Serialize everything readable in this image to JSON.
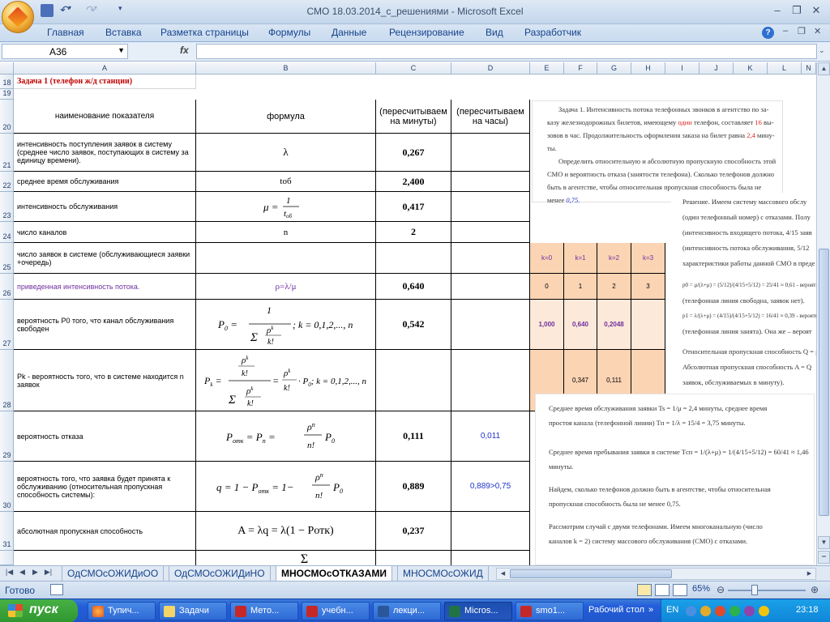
{
  "window": {
    "title": "СМО 18.03.2014_с_решениями - Microsoft Excel"
  },
  "ribbon": {
    "tabs": [
      "Главная",
      "Вставка",
      "Разметка страницы",
      "Формулы",
      "Данные",
      "Рецензирование",
      "Вид",
      "Разработчик"
    ]
  },
  "formula_bar": {
    "name_box": "A36",
    "fx": "fx",
    "value": ""
  },
  "columns": [
    "A",
    "B",
    "C",
    "D",
    "E",
    "F",
    "G",
    "H",
    "I",
    "J",
    "K",
    "L",
    "N"
  ],
  "rows": [
    "18",
    "19",
    "20",
    "21",
    "22",
    "23",
    "24",
    "25",
    "26",
    "27",
    "28",
    "29",
    "30",
    "31"
  ],
  "sheet": {
    "task_title": "Задача 1 (телефон ж/д станции)",
    "headers": {
      "name": "наименование показателя",
      "formula": "формула",
      "per_minute": "(пересчитываем на минуты)",
      "per_hour": "(пересчитываем на часы)"
    },
    "table": [
      {
        "label": "интенсивность поступления заявок в систему (среднее число заявок, поступающих в систему за единицу времени).",
        "formula": "λ",
        "value": "0,267",
        "hours": ""
      },
      {
        "label": "среднее время обслуживания",
        "formula": "tоб",
        "value": "2,400",
        "hours": ""
      },
      {
        "label": "интенсивность обслуживания",
        "formula": "μ = 1/tоб",
        "value": "0,417",
        "hours": ""
      },
      {
        "label": "число каналов",
        "formula": "n",
        "value": "2",
        "hours": ""
      },
      {
        "label": "число заявок в системе (обслуживающиеся заявки +очередь)",
        "formula": "",
        "value": "",
        "hours": ""
      },
      {
        "label": "приведенная интенсивность потока.",
        "formula": "ρ=λ/μ",
        "value": "0,640",
        "hours": ""
      },
      {
        "label": "вероятность P0 того, что канал обслуживания свободен",
        "formula": "P0 = 1 / Σ ρ^k/k! ; k = 0,1,2,..., n",
        "value": "0,542",
        "hours": ""
      },
      {
        "label": "Pk - вероятность того, что в системе находится n заявок",
        "formula": "Pk = (ρ^k/k!) / Σ ρ^k/k! = ρ^k/k! · P0 ; k = 0,1,2,..., n",
        "value": "",
        "hours": ""
      },
      {
        "label": "вероятность отказа",
        "formula": "Pотк = Pn = ρ^n/n! P0",
        "value": "0,111",
        "hours": "0,011"
      },
      {
        "label": "вероятность того, что заявка будет принята к обслуживанию (относительная пропускная способность системы):",
        "formula": "q = 1 − Pотк = 1− ρ^n/n! P0",
        "value": "0,889",
        "hours": "0,889>0,75"
      },
      {
        "label": "абсолютная пропускная способность",
        "formula": "A = λq = λ(1 − Pотк)",
        "value": "0,237",
        "hours": ""
      }
    ],
    "k_headers": [
      "k=0",
      "k=1",
      "k=2",
      "k=3"
    ],
    "k_values": [
      "0",
      "1",
      "2",
      "3"
    ],
    "p0_values": [
      "1,000",
      "0,640",
      "0,2048"
    ],
    "pk_values": [
      "0,347",
      "0,111"
    ]
  },
  "panel1": {
    "lines": [
      "Задача 1. Интенсивность потока телефонных звонков в агентство по за-",
      "казу железнодорожных билетов, имеющему",
      "один",
      "телефон, составляет",
      "16",
      "вы-",
      "зовов в час. Продолжительность оформления заказа на билет равна",
      "2,4",
      "мину-",
      "ты.",
      "Определить относительную и абсолютную пропускную способность",
      "этой СМО и вероятность отказа (занятости телефона). Сколько телефонов",
      "должно быть в агентстве, чтобы относительная пропускная способность была",
      "не менее",
      "0,75."
    ]
  },
  "panel2": {
    "lines": [
      "Решение. Имеем систему массового обслу",
      "(один телефонный номер) с отказами. Полу",
      "(интенсивность входящего потока, 4/15 заяв",
      "(интенсивность потока обслуживания, 5/12",
      "характеристики работы данной СМО в преде",
      "p0 = μ/(λ+μ) = (5/12)/(4/15+5/12) = 25/41 ≈ 0,61 - вероятнос",
      "(телефонная линия свободна, заявок нет).",
      "p1 = λ/(λ+μ) = (4/15)/(4/15+5/12) = 16/41 ≈ 0,39 - вероятнос",
      "(телефонная линия занята). Она же – вероят",
      "Относительная пропускная способность Q = μ",
      "Абсолютная пропускная способность A = Q",
      "заявок, обслуживаемых в минуту)."
    ]
  },
  "panel3": {
    "lines": [
      "Среднее время обслуживания заявки Ts = 1/μ = 2,4 минуты, среднее время",
      "простоя канала (телефонной линии) Tп = 1/λ = 15/4 = 3,75 минуты.",
      "Среднее время пребывания заявки в системе Tсп = 1/(λ+μ) = 1/(4/15+5/12) = 60/41 ≈ 1,46",
      "минуты.",
      "Найдем, сколько телефонов должно быть в агентстве, чтобы относительная",
      "пропускная способность была не менее 0,75.",
      "Рассмотрим случай с двумя телефонами. Имеем многоканальную (число",
      "каналов k = 2) систему массового обслуживания (СМО) с отказами."
    ]
  },
  "sheet_tabs": [
    "ОдСМОсОЖИДиОО",
    "ОдСМОсОЖИДиНО",
    "МНОСМОсОТКАЗАМИ",
    "МНОСМОсОЖИД"
  ],
  "active_sheet": "МНОСМОсОТКАЗАМИ",
  "status": {
    "ready": "Готово",
    "zoom": "65%"
  },
  "taskbar": {
    "start": "пуск",
    "items": [
      "Тупич...",
      "Задачи",
      "Мето...",
      "учебн...",
      "лекци...",
      "Micros...",
      "smo1...",
      "Рабочий стол"
    ],
    "lang": "EN",
    "time": "23:18"
  },
  "colors": {
    "accent": "#15428b",
    "orange_fill": "#fbd4b4",
    "peach_fill": "#fde9d9",
    "red_text": "#e02020",
    "purple_text": "#7030a0",
    "blue_text": "#1f35c8"
  }
}
